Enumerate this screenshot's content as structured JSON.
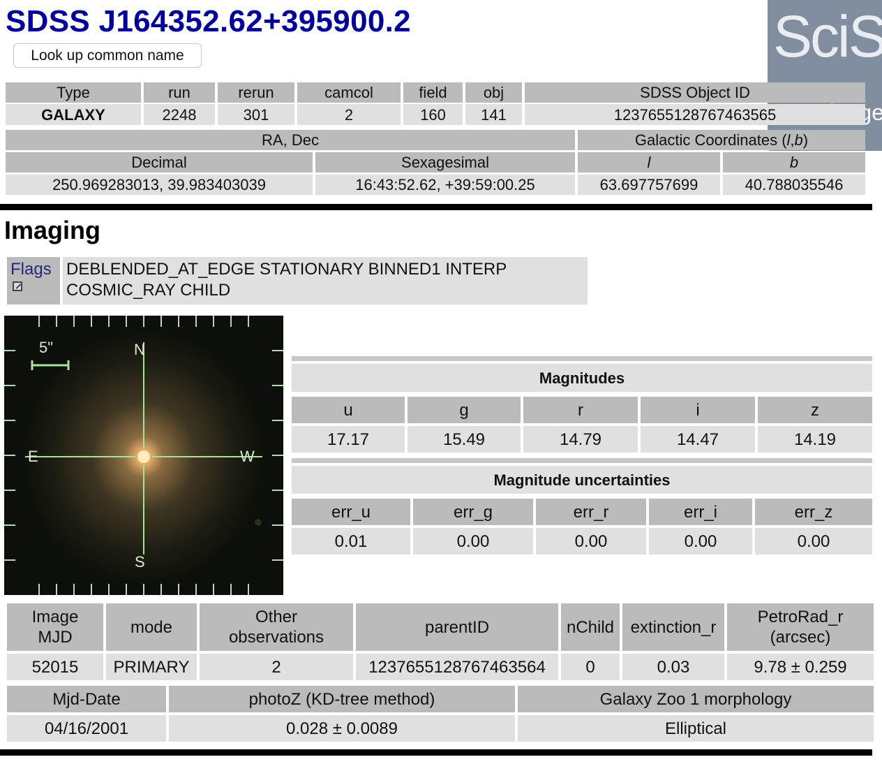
{
  "object": {
    "title": "SDSS J164352.62+395900.2",
    "lookup_button": "Look up common name"
  },
  "sciserver": {
    "logo_text": "SciServer",
    "status": "Not logged in"
  },
  "id_table": {
    "headers": [
      "Type",
      "run",
      "rerun",
      "camcol",
      "field",
      "obj",
      "SDSS Object ID"
    ],
    "values": [
      "GALAXY",
      "2248",
      "301",
      "2",
      "160",
      "141",
      "1237655128767463565"
    ]
  },
  "coords": {
    "radec_label": "RA, Dec",
    "galactic_label": "Galactic Coordinates (l, b)",
    "galactic_prefix": "Galactic Coordinates (",
    "galactic_l": "l",
    "galactic_sep": ", ",
    "galactic_b": "b",
    "galactic_suffix": ")",
    "headers": [
      "Decimal",
      "Sexagesimal",
      "l",
      "b"
    ],
    "values": [
      "250.969283013, 39.983403039",
      "16:43:52.62, +39:59:00.25",
      "63.697757699",
      "40.788035546"
    ]
  },
  "imaging": {
    "title": "Imaging",
    "flags_label": "Flags",
    "flags_line1": "DEBLENDED_AT_EDGE STATIONARY BINNED1 INTERP",
    "flags_line2": "COSMIC_RAY CHILD",
    "image": {
      "scale": "5\"",
      "north": "N",
      "south": "S",
      "east": "E",
      "west": "W"
    }
  },
  "magnitudes": {
    "title": "Magnitudes",
    "bands": [
      "u",
      "g",
      "r",
      "i",
      "z"
    ],
    "values": [
      "17.17",
      "15.49",
      "14.79",
      "14.47",
      "14.19"
    ]
  },
  "uncertainties": {
    "title": "Magnitude uncertainties",
    "bands": [
      "err_u",
      "err_g",
      "err_r",
      "err_i",
      "err_z"
    ],
    "values": [
      "0.01",
      "0.00",
      "0.00",
      "0.00",
      "0.00"
    ]
  },
  "details": {
    "headers": [
      "Image MJD",
      "mode",
      "Other observations",
      "parentID",
      "nChild",
      "extinction_r",
      "PetroRad_r (arcsec)"
    ],
    "header_lines": [
      [
        "Image",
        "MJD"
      ],
      [
        "mode"
      ],
      [
        "Other",
        "observations"
      ],
      [
        "parentID"
      ],
      [
        "nChild"
      ],
      [
        "extinction_r"
      ],
      [
        "PetroRad_r",
        "(arcsec)"
      ]
    ],
    "values": [
      "52015",
      "PRIMARY",
      "2",
      "1237655128767463564",
      "0",
      "0.03",
      "9.78 ± 0.259"
    ]
  },
  "extra": {
    "headers": [
      "Mjd-Date",
      "photoZ (KD-tree method)",
      "Galaxy Zoo 1 morphology"
    ],
    "values": [
      "04/16/2001",
      "0.028 ± 0.0089",
      "Elliptical"
    ]
  },
  "colors": {
    "title": "#000099",
    "header_bg": "#bbbbbb",
    "data_bg": "#e0e0e0",
    "link": "#26267a",
    "overlay": "#6e7e92"
  }
}
